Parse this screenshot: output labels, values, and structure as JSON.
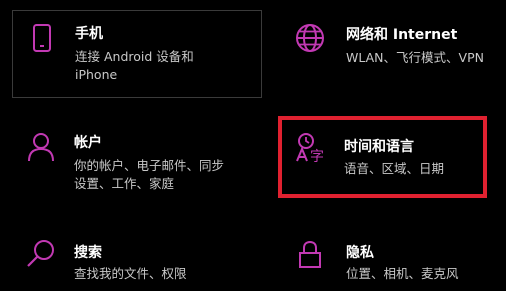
{
  "accent_color": "#c239b3",
  "selection_color": "#e02130",
  "tiles": {
    "phone": {
      "icon": "phone-icon",
      "title": "手机",
      "desc_line1": "连接 Android 设备和",
      "desc_line2": "iPhone"
    },
    "network": {
      "icon": "globe-icon",
      "title": "网络和 Internet",
      "desc_line1": "WLAN、飞行模式、VPN"
    },
    "accounts": {
      "icon": "person-icon",
      "title": "帐户",
      "desc_line1": "你的帐户、电子邮件、同步",
      "desc_line2": "设置、工作、家庭"
    },
    "time_language": {
      "icon": "time-language-icon",
      "title": "时间和语言",
      "desc_line1": "语音、区域、日期"
    },
    "search": {
      "icon": "search-icon",
      "title": "搜索",
      "desc_line1": "查找我的文件、权限"
    },
    "privacy": {
      "icon": "lock-icon",
      "title": "隐私",
      "desc_line1": "位置、相机、麦克风"
    }
  }
}
